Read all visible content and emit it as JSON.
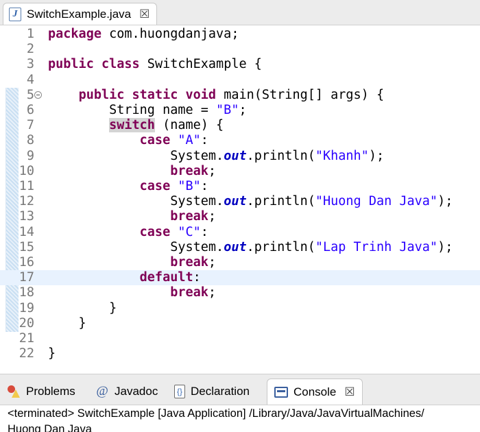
{
  "editor_tab": {
    "title": "SwitchExample.java",
    "icon": "java-file-icon",
    "close": "☒"
  },
  "code_lines": [
    {
      "n": "1",
      "t": "package com.huongdanjava;"
    },
    {
      "n": "2",
      "t": ""
    },
    {
      "n": "3",
      "t": "public class SwitchExample {"
    },
    {
      "n": "4",
      "t": ""
    },
    {
      "n": "5",
      "t": "    public static void main(String[] args) {"
    },
    {
      "n": "6",
      "t": "        String name = \"B\";"
    },
    {
      "n": "7",
      "t": "        switch (name) {"
    },
    {
      "n": "8",
      "t": "            case \"A\":"
    },
    {
      "n": "9",
      "t": "                System.out.println(\"Khanh\");"
    },
    {
      "n": "10",
      "t": "                break;"
    },
    {
      "n": "11",
      "t": "            case \"B\":"
    },
    {
      "n": "12",
      "t": "                System.out.println(\"Huong Dan Java\");"
    },
    {
      "n": "13",
      "t": "                break;"
    },
    {
      "n": "14",
      "t": "            case \"C\":"
    },
    {
      "n": "15",
      "t": "                System.out.println(\"Lap Trinh Java\");"
    },
    {
      "n": "16",
      "t": "                break;"
    },
    {
      "n": "17",
      "t": "            default:"
    },
    {
      "n": "18",
      "t": "                break;"
    },
    {
      "n": "19",
      "t": "        }"
    },
    {
      "n": "20",
      "t": "    }"
    },
    {
      "n": "21",
      "t": ""
    },
    {
      "n": "22",
      "t": "}"
    }
  ],
  "current_line": "17",
  "panel_tabs": [
    {
      "label": "Problems",
      "icon": "problems-icon"
    },
    {
      "label": "Javadoc",
      "icon": "at-icon"
    },
    {
      "label": "Declaration",
      "icon": "declaration-icon"
    },
    {
      "label": "Console",
      "icon": "console-icon",
      "active": true,
      "close": "☒"
    }
  ],
  "console": {
    "status": "<terminated> SwitchExample [Java Application] /Library/Java/JavaVirtualMachines/",
    "output": "Huong Dan Java"
  },
  "colors": {
    "keyword": "#7f0055",
    "string": "#2a00ff",
    "field": "#0000c0",
    "current_line": "#e8f2fe"
  }
}
